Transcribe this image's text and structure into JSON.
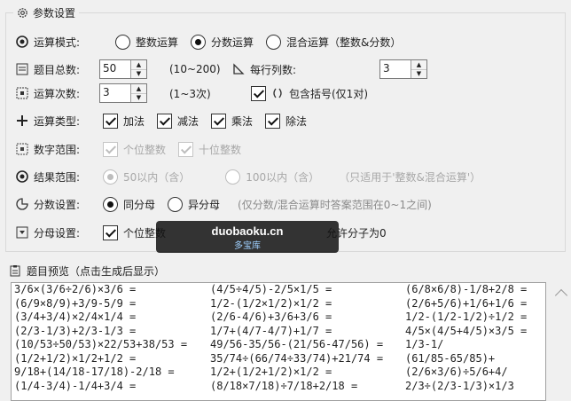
{
  "params": {
    "title": "参数设置",
    "mode": {
      "label": "运算模式:",
      "options": [
        "整数运算",
        "分数运算",
        "混合运算（整数&分数）"
      ],
      "selected": 1
    },
    "total": {
      "label": "题目总数:",
      "value": "50",
      "range": "(10~200)"
    },
    "per_row": {
      "label": "每行列数:",
      "value": "3"
    },
    "times": {
      "label": "运算次数:",
      "value": "3",
      "range": "(1~3次)"
    },
    "brackets": {
      "label": "包含括号(仅1对)",
      "checked": true
    },
    "types": {
      "label": "运算类型:",
      "options": [
        "加法",
        "减法",
        "乘法",
        "除法"
      ]
    },
    "num_range": {
      "label": "数字范围:",
      "options": [
        "个位整数",
        "十位整数"
      ]
    },
    "result_range": {
      "label": "结果范围:",
      "options": [
        "50以内（含）",
        "100以内（含）"
      ],
      "hint": "（只适用于'整数&混合运算'）"
    },
    "fraction": {
      "label": "分数设置:",
      "options": [
        "同分母",
        "异分母"
      ],
      "selected": 0,
      "hint": "(仅分数/混合运算时答案范围在0~1之间)"
    },
    "denominator": {
      "label": "分母设置:",
      "opt1": "个位整数",
      "opt2_tail": "允许分子为0"
    }
  },
  "watermark": {
    "main": "duobaoku.cn",
    "sub": "多宝库"
  },
  "preview": {
    "title": "题目预览（点击生成后显示）",
    "lines": [
      [
        "3/6×(3/6÷2/6)×3/6 =",
        "(4/5÷4/5)-2/5×1/5 =",
        "(6/8×6/8)-1/8+2/8 ="
      ],
      [
        "(6/9×8/9)+3/9-5/9 =",
        "1/2-(1/2×1/2)×1/2 =",
        "(2/6+5/6)+1/6+1/6 ="
      ],
      [
        "(3/4+3/4)×2/4×1/4 =",
        "(2/6-4/6)+3/6+3/6 =",
        "1/2-(1/2-1/2)÷1/2 ="
      ],
      [
        "(2/3-1/3)+2/3-1/3 =",
        "1/7+(4/7-4/7)+1/7 =",
        "4/5×(4/5+4/5)×3/5 ="
      ],
      [
        "(10/53÷50/53)×22/53+38/53 =",
        "49/56-35/56-(21/56-47/56) =",
        "1/3-1/"
      ],
      [
        "(1/2+1/2)×1/2+1/2 =",
        "35/74÷(66/74÷33/74)+21/74 =",
        "(61/85-65/85)+"
      ],
      [
        "9/18+(14/18-17/18)-2/18 =",
        "1/2+(1/2+1/2)×1/2 =",
        "(2/6×3/6)÷5/6+4/"
      ],
      [
        "(1/4-3/4)-1/4+3/4 =",
        "(8/18×7/18)÷7/18+2/18 =",
        "2/3÷(2/3-1/3)×1/3"
      ]
    ]
  }
}
